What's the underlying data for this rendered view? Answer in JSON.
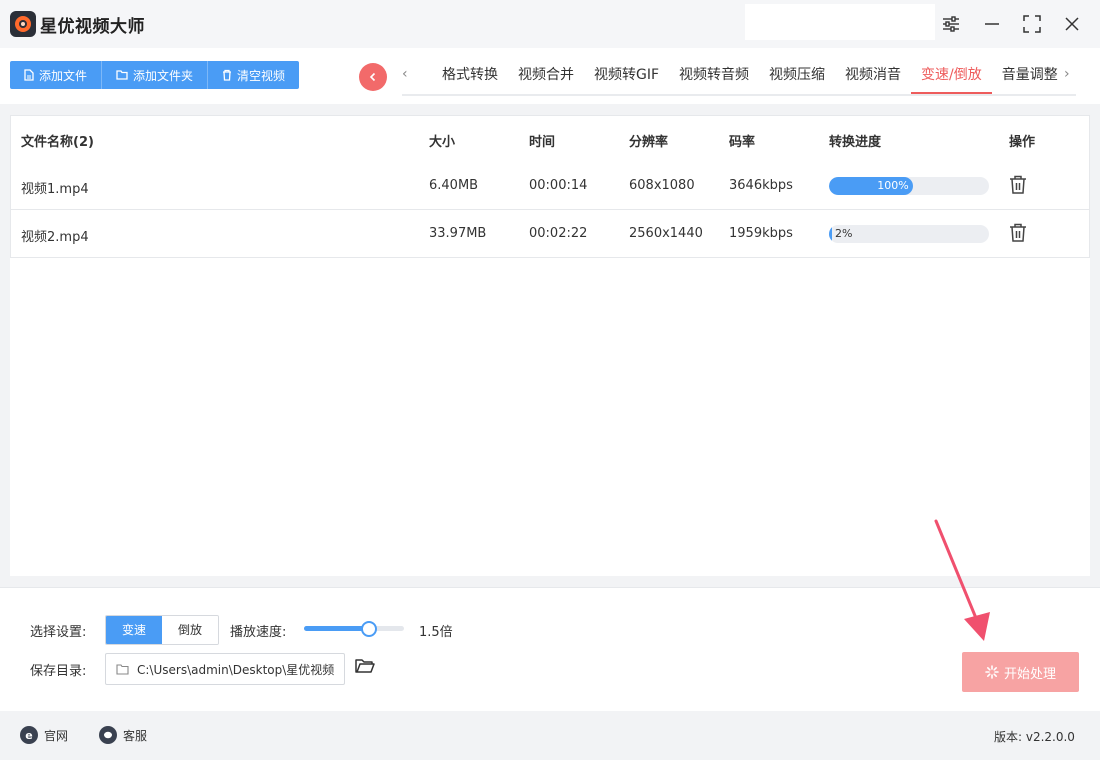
{
  "app": {
    "title": "星优视频大师"
  },
  "toolbar": {
    "add_file": "添加文件",
    "add_folder": "添加文件夹",
    "clear": "清空视频"
  },
  "tabs": [
    "格式转换",
    "视频合并",
    "视频转GIF",
    "视频转音频",
    "视频压缩",
    "视频消音",
    "变速/倒放",
    "音量调整"
  ],
  "active_tab": "变速/倒放",
  "table": {
    "headers": [
      "文件名称(2)",
      "大小",
      "时间",
      "分辨率",
      "码率",
      "转换进度",
      "操作"
    ],
    "rows": [
      {
        "name": "视频1.mp4",
        "size": "6.40MB",
        "time": "00:00:14",
        "resolution": "608x1080",
        "bitrate": "3646kbps",
        "progress": 100,
        "progress_label": "100%"
      },
      {
        "name": "视频2.mp4",
        "size": "33.97MB",
        "time": "00:02:22",
        "resolution": "2560x1440",
        "bitrate": "1959kbps",
        "progress": 2,
        "progress_label": "2%"
      }
    ]
  },
  "settings": {
    "mode_label": "选择设置:",
    "mode_options": [
      "变速",
      "倒放"
    ],
    "mode_selected": "变速",
    "speed_label": "播放速度:",
    "speed_value": "1.5倍",
    "speed_fraction": 0.65,
    "save_label": "保存目录:",
    "save_path": "C:\\Users\\admin\\Desktop\\星优视频"
  },
  "start_button": "开始处理",
  "footer": {
    "website": "官网",
    "support": "客服",
    "version": "版本: v2.2.0.0"
  },
  "colors": {
    "accent": "#4a9cf5",
    "active_tab": "#ee5c5c",
    "start_button": "#f7a3a3",
    "arrow": "#f0506e"
  }
}
